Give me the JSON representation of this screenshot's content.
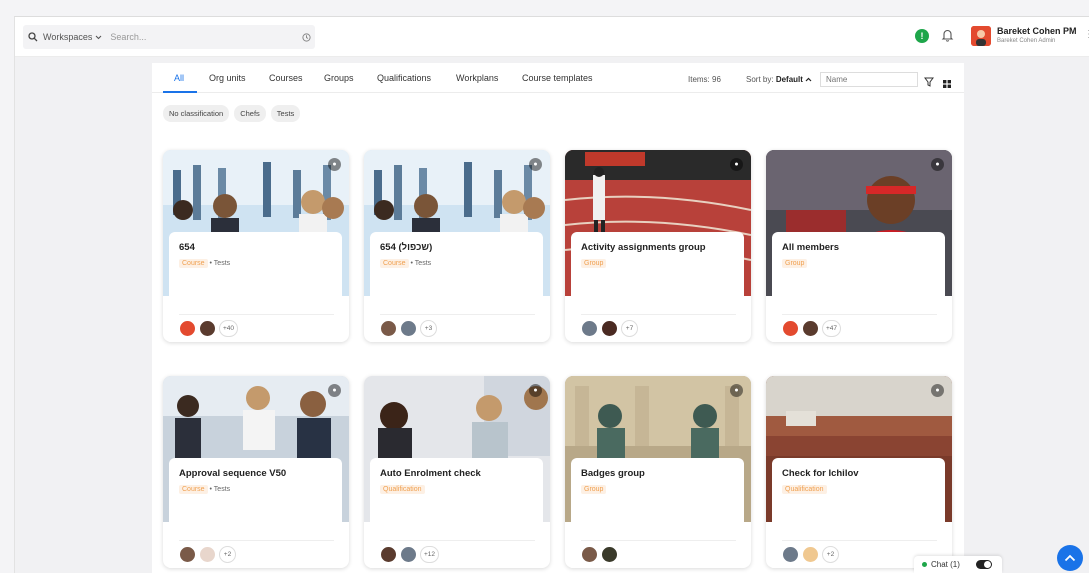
{
  "topbar": {
    "workspaces_label": "Workspaces",
    "search_placeholder": "Search...",
    "alert_badge": "!",
    "user_name": "Bareket Cohen PM",
    "user_role": "Bareket Cohen Admin"
  },
  "tabs": [
    "All",
    "Org units",
    "Courses",
    "Groups",
    "Qualifications",
    "Workplans",
    "Course templates"
  ],
  "toolbar": {
    "items_text": "Items: 96",
    "sort_prefix": "Sort by:",
    "sort_value": "Default",
    "name_placeholder": "Name"
  },
  "filter_chips": [
    "No classification",
    "Chefs",
    "Tests"
  ],
  "cards": [
    {
      "title": "654",
      "badge": "Course",
      "tag": "• Tests",
      "extra_count": "+40",
      "image": "business-team-photo"
    },
    {
      "title": "654 (שכפול)",
      "badge": "Course",
      "tag": "• Tests",
      "extra_count": "+3",
      "image": "business-team-photo"
    },
    {
      "title": "Activity assignments group",
      "badge": "Group",
      "tag": "",
      "extra_count": "+7",
      "image": "running-track-photo"
    },
    {
      "title": "All members",
      "badge": "Group",
      "tag": "",
      "extra_count": "+47",
      "image": "basketball-player-photo"
    },
    {
      "title": "Approval sequence V50",
      "badge": "Course",
      "tag": "• Tests",
      "extra_count": "+2",
      "image": "office-meeting-photo"
    },
    {
      "title": "Auto Enrolment check",
      "badge": "Qualification",
      "tag": "",
      "extra_count": "+12",
      "image": "office-colleagues-photo"
    },
    {
      "title": "Badges group",
      "badge": "Group",
      "tag": "",
      "extra_count": "",
      "image": "statues-photo"
    },
    {
      "title": "Check for Ichilov",
      "badge": "Qualification",
      "tag": "",
      "extra_count": "+2",
      "image": "conference-hall-photo"
    }
  ],
  "chat": {
    "label": "Chat (1)"
  },
  "colors": {
    "accent": "#1a73e8",
    "badge_text": "#f0a050",
    "badge_bg": "#fdf0e4",
    "online": "#1ea64a"
  }
}
